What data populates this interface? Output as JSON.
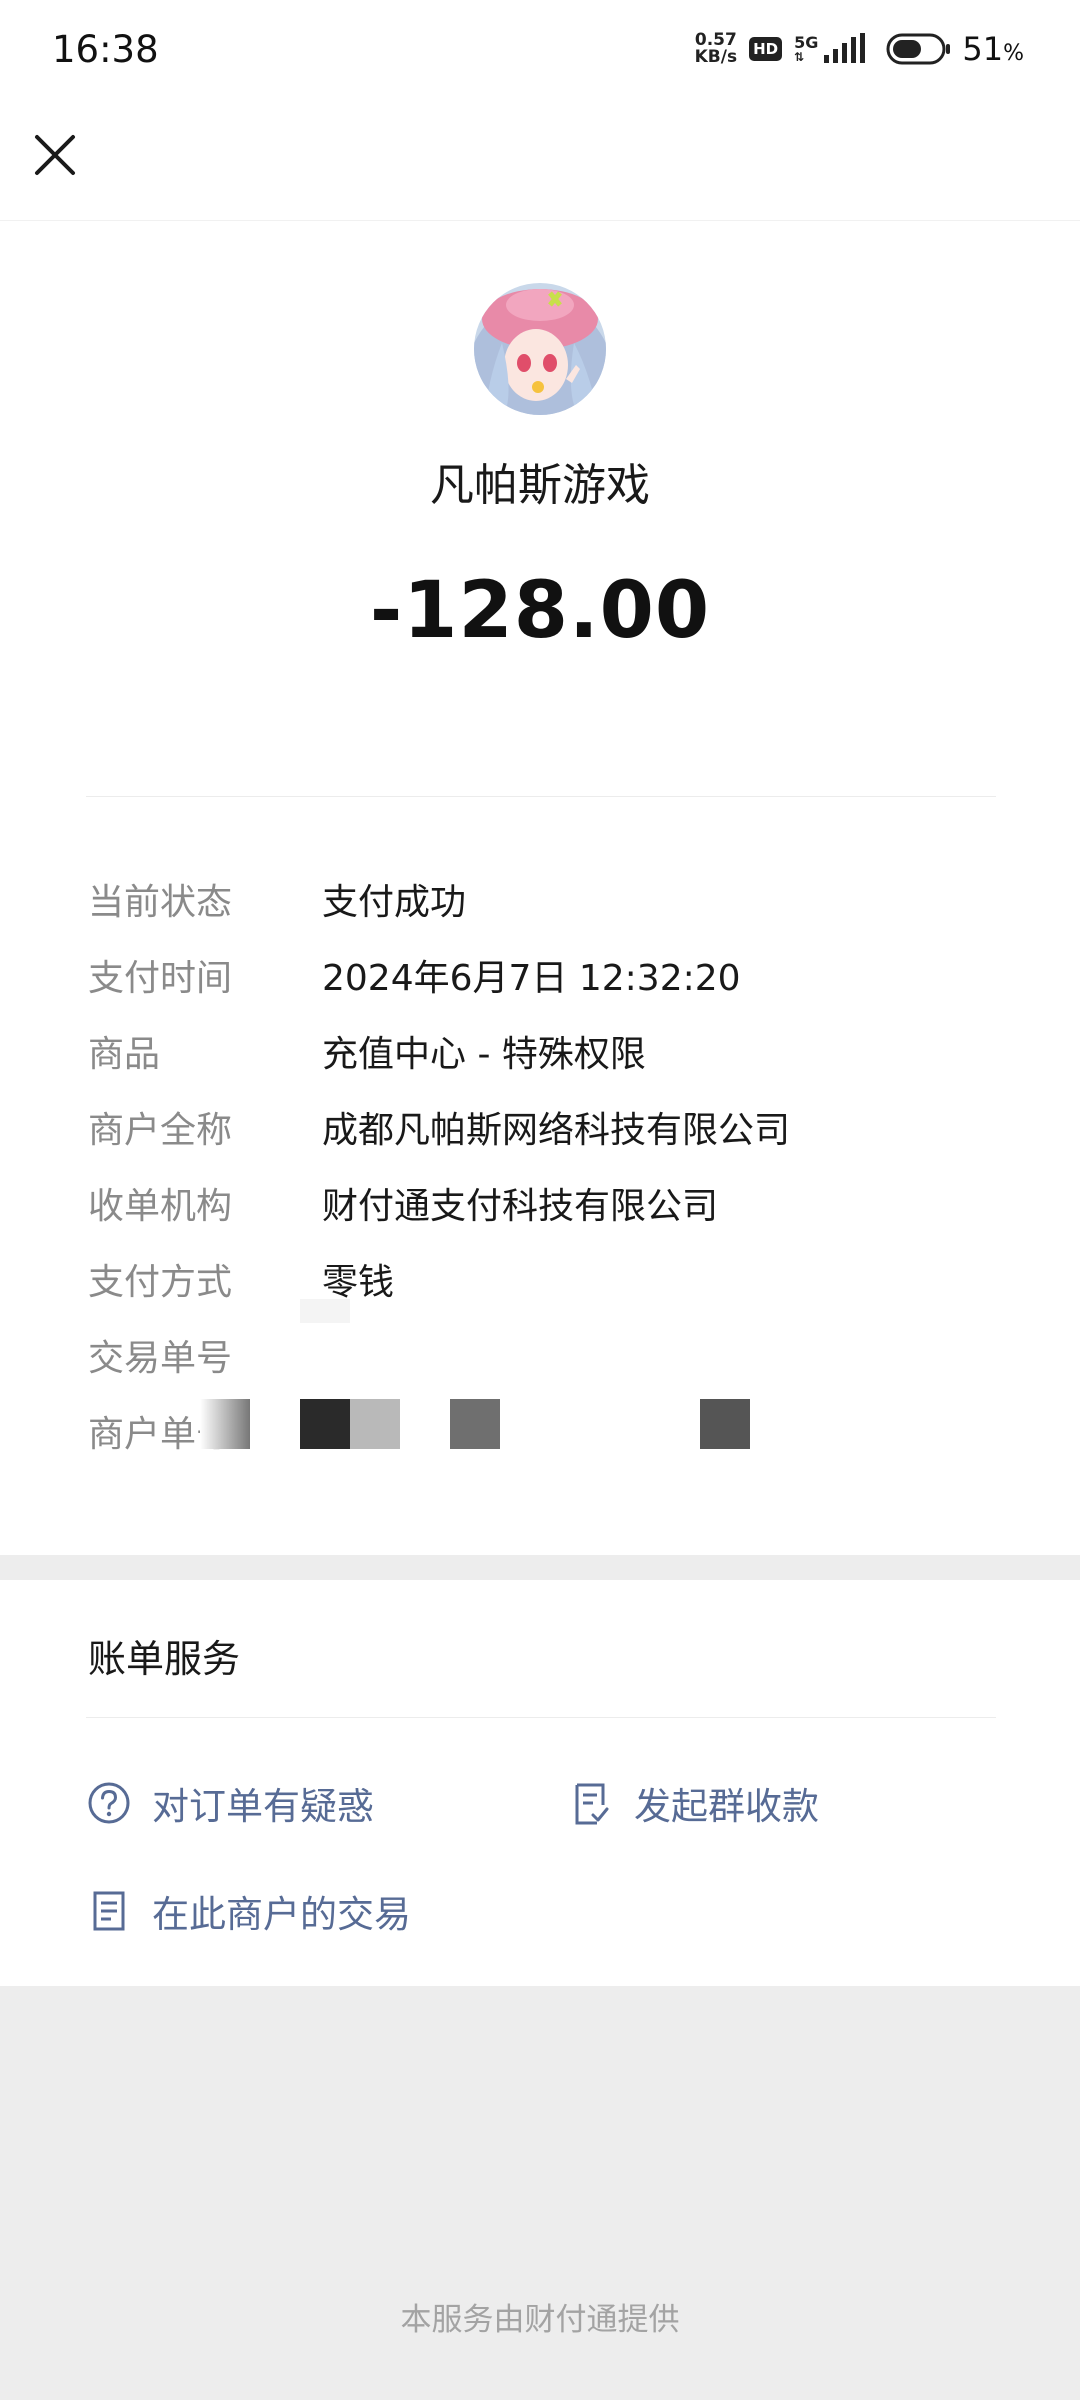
{
  "status_bar": {
    "time": "16:38",
    "net_speed_value": "0.57",
    "net_speed_unit": "KB/s",
    "hd_badge": "HD",
    "network": "5G",
    "battery_percent": "51",
    "battery_unit": "%",
    "icons": [
      "hd-icon",
      "signal-icon",
      "battery-icon"
    ]
  },
  "header": {
    "close_icon": "close-icon"
  },
  "summary": {
    "merchant_name": "凡帕斯游戏",
    "amount": "-128.00"
  },
  "details": [
    {
      "label": "当前状态",
      "value": "支付成功"
    },
    {
      "label": "支付时间",
      "value": "2024年6月7日 12:32:20"
    },
    {
      "label": "商品",
      "value": "充值中心 - 特殊权限"
    },
    {
      "label": "商户全称",
      "value": "成都凡帕斯网络科技有限公司"
    },
    {
      "label": "收单机构",
      "value": "财付通支付科技有限公司"
    },
    {
      "label": "支付方式",
      "value": "零钱"
    },
    {
      "label": "交易单号",
      "value": ""
    },
    {
      "label": "商户单号",
      "value": ""
    }
  ],
  "service": {
    "title": "账单服务",
    "links": {
      "dispute": {
        "label": "对订单有疑惑",
        "icon": "question-circle-icon"
      },
      "group_collect": {
        "label": "发起群收款",
        "icon": "checklist-icon"
      },
      "merchant_trades": {
        "label": "在此商户的交易",
        "icon": "document-icon"
      }
    }
  },
  "footer": {
    "provider_text": "本服务由财付通提供"
  },
  "colors": {
    "link": "#576b95",
    "label": "#8a8a8a",
    "text": "#191919",
    "page_bg": "#ededed"
  }
}
